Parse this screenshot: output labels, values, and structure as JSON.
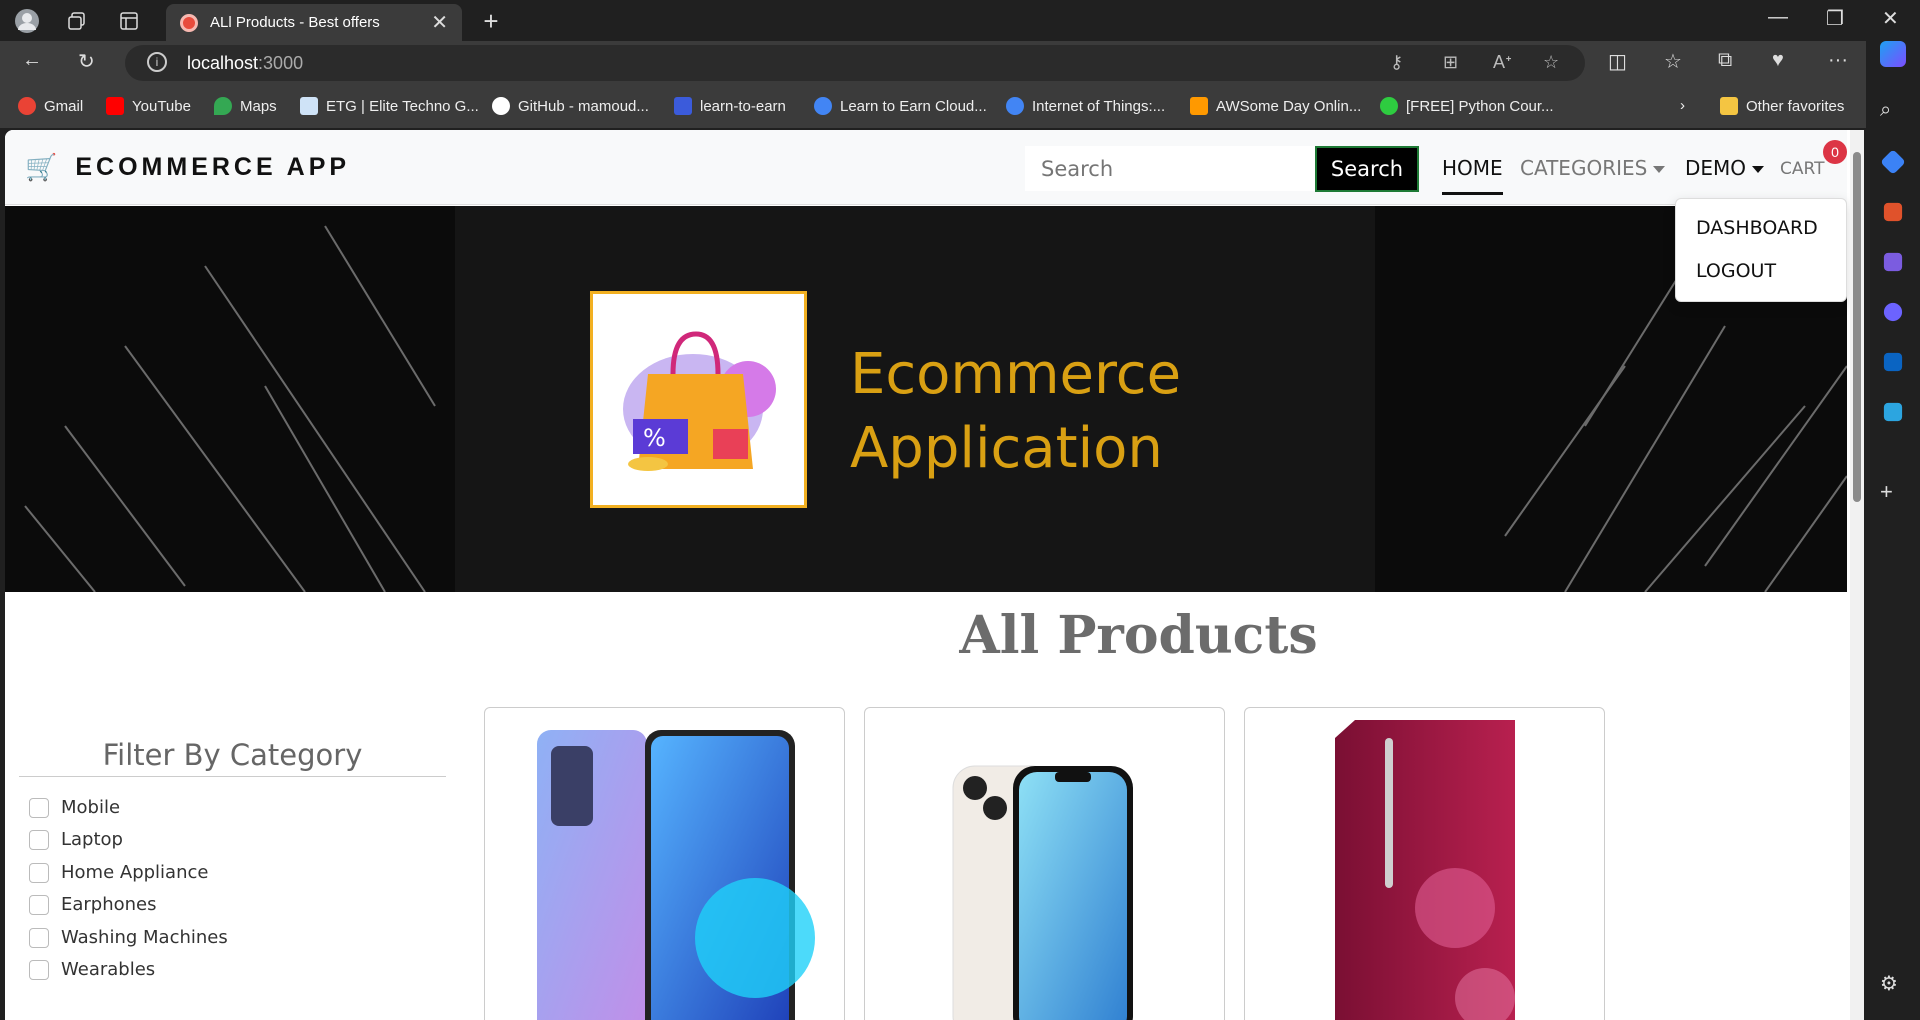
{
  "browser": {
    "tab_title": "ALl Products - Best offers",
    "url_host": "localhost",
    "url_port": ":3000",
    "bookmarks": [
      "Gmail",
      "YouTube",
      "Maps",
      "ETG | Elite Techno G...",
      "GitHub - mamoud...",
      "learn-to-earn",
      "Learn to Earn Cloud...",
      "Internet of Things:...",
      "AWSome Day Onlin...",
      "[FREE] Python Cour..."
    ],
    "other_favorites": "Other favorites"
  },
  "app": {
    "brand": "ECOMMERCE APP",
    "search_placeholder": "Search",
    "search_button": "Search",
    "nav": {
      "home": "HOME",
      "categories": "CATEGORIES",
      "demo": "DEMO",
      "cart": "CART",
      "cart_count": "0"
    },
    "dropdown": {
      "dashboard": "DASHBOARD",
      "logout": "LOGOUT"
    },
    "banner_line1": "Ecommerce",
    "banner_line2": "Application",
    "heading": "All Products",
    "filter_title": "Filter By Category",
    "categories": [
      "Mobile",
      "Laptop",
      "Home Appliance",
      "Earphones",
      "Washing Machines",
      "Wearables"
    ]
  },
  "colors": {
    "brand_gold": "#d9a013",
    "badge": "#dc3545",
    "text_gray": "#6c6c6c"
  }
}
